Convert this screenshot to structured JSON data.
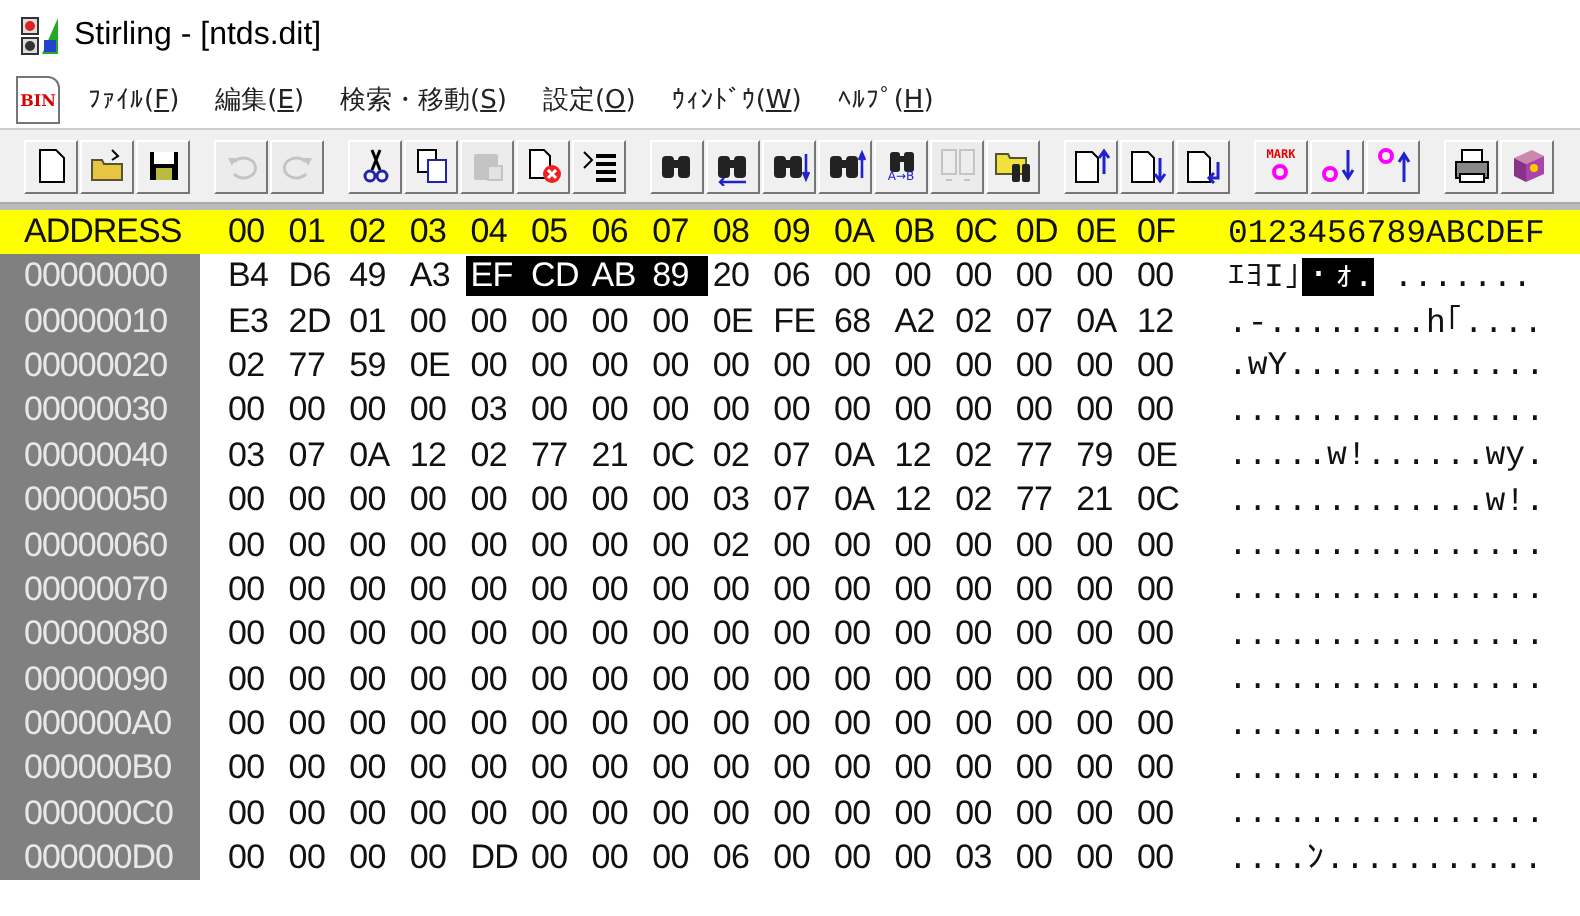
{
  "window": {
    "title": "Stirling - [ntds.dit]"
  },
  "menu": {
    "icon_caption": "BIN",
    "items": [
      {
        "label": "ﾌｧｲﾙ(F)"
      },
      {
        "label": "編集(E)"
      },
      {
        "label": "検索・移動(S)"
      },
      {
        "label": "設定(O)"
      },
      {
        "label": "ｳｨﾝﾄﾞｳ(W)"
      },
      {
        "label": "ﾍﾙﾌﾟ(H)"
      }
    ]
  },
  "toolbar": {
    "groups": [
      {
        "items": [
          {
            "kind": "new",
            "disabled": false
          },
          {
            "kind": "open",
            "disabled": false
          },
          {
            "kind": "save",
            "disabled": false
          }
        ]
      },
      {
        "items": [
          {
            "kind": "undo",
            "disabled": true
          },
          {
            "kind": "redo",
            "disabled": true
          }
        ]
      },
      {
        "items": [
          {
            "kind": "cut",
            "disabled": false
          },
          {
            "kind": "copy",
            "disabled": false
          },
          {
            "kind": "paste",
            "disabled": true
          },
          {
            "kind": "delete",
            "disabled": false
          },
          {
            "kind": "list",
            "disabled": false
          }
        ]
      },
      {
        "items": [
          {
            "kind": "find",
            "disabled": false
          },
          {
            "kind": "replace",
            "disabled": false
          },
          {
            "kind": "find-down",
            "disabled": false
          },
          {
            "kind": "find-up",
            "disabled": false
          },
          {
            "kind": "compare",
            "caption": "A→B",
            "disabled": false
          },
          {
            "kind": "pages",
            "disabled": true
          },
          {
            "kind": "folder-find",
            "disabled": false
          }
        ]
      },
      {
        "items": [
          {
            "kind": "page-up",
            "disabled": false
          },
          {
            "kind": "page-down",
            "disabled": false
          },
          {
            "kind": "page-jump",
            "disabled": false
          }
        ]
      },
      {
        "items": [
          {
            "kind": "mark",
            "caption": "MARK",
            "disabled": false
          },
          {
            "kind": "mark-down",
            "disabled": false
          },
          {
            "kind": "mark-up",
            "disabled": false
          }
        ]
      },
      {
        "items": [
          {
            "kind": "print",
            "disabled": false
          },
          {
            "kind": "help",
            "disabled": false
          }
        ]
      }
    ]
  },
  "hex": {
    "header": {
      "address": "ADDRESS",
      "columns": [
        "00",
        "01",
        "02",
        "03",
        "04",
        "05",
        "06",
        "07",
        "08",
        "09",
        "0A",
        "0B",
        "0C",
        "0D",
        "0E",
        "0F"
      ],
      "ascii": "0123456789ABCDEF"
    },
    "rows": [
      {
        "address": "00000000",
        "bytes": [
          {
            "value": "B4",
            "selected": false
          },
          {
            "value": "D6",
            "selected": false
          },
          {
            "value": "49",
            "selected": false
          },
          {
            "value": "A3",
            "selected": false
          },
          {
            "value": "EF",
            "selected": true
          },
          {
            "value": "CD",
            "selected": true
          },
          {
            "value": "AB",
            "selected": true
          },
          {
            "value": "89",
            "selected": true
          },
          {
            "value": "20",
            "selected": false
          },
          {
            "value": "06",
            "selected": false
          },
          {
            "value": "00",
            "selected": false
          },
          {
            "value": "00",
            "selected": false
          },
          {
            "value": "00",
            "selected": false
          },
          {
            "value": "00",
            "selected": false
          },
          {
            "value": "00",
            "selected": false
          },
          {
            "value": "00",
            "selected": false
          }
        ],
        "ascii": [
          {
            "text": "ｴﾖI｣",
            "selected": false
          },
          {
            "text": "・ｫ.",
            "selected": true
          },
          {
            "text": " .......",
            "selected": false
          }
        ]
      },
      {
        "address": "00000010",
        "bytes": [
          {
            "value": "E3",
            "selected": false
          },
          {
            "value": "2D",
            "selected": false
          },
          {
            "value": "01",
            "selected": false
          },
          {
            "value": "00",
            "selected": false
          },
          {
            "value": "00",
            "selected": false
          },
          {
            "value": "00",
            "selected": false
          },
          {
            "value": "00",
            "selected": false
          },
          {
            "value": "00",
            "selected": false
          },
          {
            "value": "0E",
            "selected": false
          },
          {
            "value": "FE",
            "selected": false
          },
          {
            "value": "68",
            "selected": false
          },
          {
            "value": "A2",
            "selected": false
          },
          {
            "value": "02",
            "selected": false
          },
          {
            "value": "07",
            "selected": false
          },
          {
            "value": "0A",
            "selected": false
          },
          {
            "value": "12",
            "selected": false
          }
        ],
        "ascii": [
          {
            "text": ".-........h｢....",
            "selected": false
          }
        ]
      },
      {
        "address": "00000020",
        "bytes": [
          {
            "value": "02",
            "selected": false
          },
          {
            "value": "77",
            "selected": false
          },
          {
            "value": "59",
            "selected": false
          },
          {
            "value": "0E",
            "selected": false
          },
          {
            "value": "00",
            "selected": false
          },
          {
            "value": "00",
            "selected": false
          },
          {
            "value": "00",
            "selected": false
          },
          {
            "value": "00",
            "selected": false
          },
          {
            "value": "00",
            "selected": false
          },
          {
            "value": "00",
            "selected": false
          },
          {
            "value": "00",
            "selected": false
          },
          {
            "value": "00",
            "selected": false
          },
          {
            "value": "00",
            "selected": false
          },
          {
            "value": "00",
            "selected": false
          },
          {
            "value": "00",
            "selected": false
          },
          {
            "value": "00",
            "selected": false
          }
        ],
        "ascii": [
          {
            "text": ".wY.............",
            "selected": false
          }
        ]
      },
      {
        "address": "00000030",
        "bytes": [
          {
            "value": "00",
            "selected": false
          },
          {
            "value": "00",
            "selected": false
          },
          {
            "value": "00",
            "selected": false
          },
          {
            "value": "00",
            "selected": false
          },
          {
            "value": "03",
            "selected": false
          },
          {
            "value": "00",
            "selected": false
          },
          {
            "value": "00",
            "selected": false
          },
          {
            "value": "00",
            "selected": false
          },
          {
            "value": "00",
            "selected": false
          },
          {
            "value": "00",
            "selected": false
          },
          {
            "value": "00",
            "selected": false
          },
          {
            "value": "00",
            "selected": false
          },
          {
            "value": "00",
            "selected": false
          },
          {
            "value": "00",
            "selected": false
          },
          {
            "value": "00",
            "selected": false
          },
          {
            "value": "00",
            "selected": false
          }
        ],
        "ascii": [
          {
            "text": "................",
            "selected": false
          }
        ]
      },
      {
        "address": "00000040",
        "bytes": [
          {
            "value": "03",
            "selected": false
          },
          {
            "value": "07",
            "selected": false
          },
          {
            "value": "0A",
            "selected": false
          },
          {
            "value": "12",
            "selected": false
          },
          {
            "value": "02",
            "selected": false
          },
          {
            "value": "77",
            "selected": false
          },
          {
            "value": "21",
            "selected": false
          },
          {
            "value": "0C",
            "selected": false
          },
          {
            "value": "02",
            "selected": false
          },
          {
            "value": "07",
            "selected": false
          },
          {
            "value": "0A",
            "selected": false
          },
          {
            "value": "12",
            "selected": false
          },
          {
            "value": "02",
            "selected": false
          },
          {
            "value": "77",
            "selected": false
          },
          {
            "value": "79",
            "selected": false
          },
          {
            "value": "0E",
            "selected": false
          }
        ],
        "ascii": [
          {
            "text": ".....w!......wy.",
            "selected": false
          }
        ]
      },
      {
        "address": "00000050",
        "bytes": [
          {
            "value": "00",
            "selected": false
          },
          {
            "value": "00",
            "selected": false
          },
          {
            "value": "00",
            "selected": false
          },
          {
            "value": "00",
            "selected": false
          },
          {
            "value": "00",
            "selected": false
          },
          {
            "value": "00",
            "selected": false
          },
          {
            "value": "00",
            "selected": false
          },
          {
            "value": "00",
            "selected": false
          },
          {
            "value": "03",
            "selected": false
          },
          {
            "value": "07",
            "selected": false
          },
          {
            "value": "0A",
            "selected": false
          },
          {
            "value": "12",
            "selected": false
          },
          {
            "value": "02",
            "selected": false
          },
          {
            "value": "77",
            "selected": false
          },
          {
            "value": "21",
            "selected": false
          },
          {
            "value": "0C",
            "selected": false
          }
        ],
        "ascii": [
          {
            "text": ".............w!.",
            "selected": false
          }
        ]
      },
      {
        "address": "00000060",
        "bytes": [
          {
            "value": "00",
            "selected": false
          },
          {
            "value": "00",
            "selected": false
          },
          {
            "value": "00",
            "selected": false
          },
          {
            "value": "00",
            "selected": false
          },
          {
            "value": "00",
            "selected": false
          },
          {
            "value": "00",
            "selected": false
          },
          {
            "value": "00",
            "selected": false
          },
          {
            "value": "00",
            "selected": false
          },
          {
            "value": "02",
            "selected": false
          },
          {
            "value": "00",
            "selected": false
          },
          {
            "value": "00",
            "selected": false
          },
          {
            "value": "00",
            "selected": false
          },
          {
            "value": "00",
            "selected": false
          },
          {
            "value": "00",
            "selected": false
          },
          {
            "value": "00",
            "selected": false
          },
          {
            "value": "00",
            "selected": false
          }
        ],
        "ascii": [
          {
            "text": "................",
            "selected": false
          }
        ]
      },
      {
        "address": "00000070",
        "bytes": [
          {
            "value": "00",
            "selected": false
          },
          {
            "value": "00",
            "selected": false
          },
          {
            "value": "00",
            "selected": false
          },
          {
            "value": "00",
            "selected": false
          },
          {
            "value": "00",
            "selected": false
          },
          {
            "value": "00",
            "selected": false
          },
          {
            "value": "00",
            "selected": false
          },
          {
            "value": "00",
            "selected": false
          },
          {
            "value": "00",
            "selected": false
          },
          {
            "value": "00",
            "selected": false
          },
          {
            "value": "00",
            "selected": false
          },
          {
            "value": "00",
            "selected": false
          },
          {
            "value": "00",
            "selected": false
          },
          {
            "value": "00",
            "selected": false
          },
          {
            "value": "00",
            "selected": false
          },
          {
            "value": "00",
            "selected": false
          }
        ],
        "ascii": [
          {
            "text": "................",
            "selected": false
          }
        ]
      },
      {
        "address": "00000080",
        "bytes": [
          {
            "value": "00",
            "selected": false
          },
          {
            "value": "00",
            "selected": false
          },
          {
            "value": "00",
            "selected": false
          },
          {
            "value": "00",
            "selected": false
          },
          {
            "value": "00",
            "selected": false
          },
          {
            "value": "00",
            "selected": false
          },
          {
            "value": "00",
            "selected": false
          },
          {
            "value": "00",
            "selected": false
          },
          {
            "value": "00",
            "selected": false
          },
          {
            "value": "00",
            "selected": false
          },
          {
            "value": "00",
            "selected": false
          },
          {
            "value": "00",
            "selected": false
          },
          {
            "value": "00",
            "selected": false
          },
          {
            "value": "00",
            "selected": false
          },
          {
            "value": "00",
            "selected": false
          },
          {
            "value": "00",
            "selected": false
          }
        ],
        "ascii": [
          {
            "text": "................",
            "selected": false
          }
        ]
      },
      {
        "address": "00000090",
        "bytes": [
          {
            "value": "00",
            "selected": false
          },
          {
            "value": "00",
            "selected": false
          },
          {
            "value": "00",
            "selected": false
          },
          {
            "value": "00",
            "selected": false
          },
          {
            "value": "00",
            "selected": false
          },
          {
            "value": "00",
            "selected": false
          },
          {
            "value": "00",
            "selected": false
          },
          {
            "value": "00",
            "selected": false
          },
          {
            "value": "00",
            "selected": false
          },
          {
            "value": "00",
            "selected": false
          },
          {
            "value": "00",
            "selected": false
          },
          {
            "value": "00",
            "selected": false
          },
          {
            "value": "00",
            "selected": false
          },
          {
            "value": "00",
            "selected": false
          },
          {
            "value": "00",
            "selected": false
          },
          {
            "value": "00",
            "selected": false
          }
        ],
        "ascii": [
          {
            "text": "................",
            "selected": false
          }
        ]
      },
      {
        "address": "000000A0",
        "bytes": [
          {
            "value": "00",
            "selected": false
          },
          {
            "value": "00",
            "selected": false
          },
          {
            "value": "00",
            "selected": false
          },
          {
            "value": "00",
            "selected": false
          },
          {
            "value": "00",
            "selected": false
          },
          {
            "value": "00",
            "selected": false
          },
          {
            "value": "00",
            "selected": false
          },
          {
            "value": "00",
            "selected": false
          },
          {
            "value": "00",
            "selected": false
          },
          {
            "value": "00",
            "selected": false
          },
          {
            "value": "00",
            "selected": false
          },
          {
            "value": "00",
            "selected": false
          },
          {
            "value": "00",
            "selected": false
          },
          {
            "value": "00",
            "selected": false
          },
          {
            "value": "00",
            "selected": false
          },
          {
            "value": "00",
            "selected": false
          }
        ],
        "ascii": [
          {
            "text": "................",
            "selected": false
          }
        ]
      },
      {
        "address": "000000B0",
        "bytes": [
          {
            "value": "00",
            "selected": false
          },
          {
            "value": "00",
            "selected": false
          },
          {
            "value": "00",
            "selected": false
          },
          {
            "value": "00",
            "selected": false
          },
          {
            "value": "00",
            "selected": false
          },
          {
            "value": "00",
            "selected": false
          },
          {
            "value": "00",
            "selected": false
          },
          {
            "value": "00",
            "selected": false
          },
          {
            "value": "00",
            "selected": false
          },
          {
            "value": "00",
            "selected": false
          },
          {
            "value": "00",
            "selected": false
          },
          {
            "value": "00",
            "selected": false
          },
          {
            "value": "00",
            "selected": false
          },
          {
            "value": "00",
            "selected": false
          },
          {
            "value": "00",
            "selected": false
          },
          {
            "value": "00",
            "selected": false
          }
        ],
        "ascii": [
          {
            "text": "................",
            "selected": false
          }
        ]
      },
      {
        "address": "000000C0",
        "bytes": [
          {
            "value": "00",
            "selected": false
          },
          {
            "value": "00",
            "selected": false
          },
          {
            "value": "00",
            "selected": false
          },
          {
            "value": "00",
            "selected": false
          },
          {
            "value": "00",
            "selected": false
          },
          {
            "value": "00",
            "selected": false
          },
          {
            "value": "00",
            "selected": false
          },
          {
            "value": "00",
            "selected": false
          },
          {
            "value": "00",
            "selected": false
          },
          {
            "value": "00",
            "selected": false
          },
          {
            "value": "00",
            "selected": false
          },
          {
            "value": "00",
            "selected": false
          },
          {
            "value": "00",
            "selected": false
          },
          {
            "value": "00",
            "selected": false
          },
          {
            "value": "00",
            "selected": false
          },
          {
            "value": "00",
            "selected": false
          }
        ],
        "ascii": [
          {
            "text": "................",
            "selected": false
          }
        ]
      },
      {
        "address": "000000D0",
        "bytes": [
          {
            "value": "00",
            "selected": false
          },
          {
            "value": "00",
            "selected": false
          },
          {
            "value": "00",
            "selected": false
          },
          {
            "value": "00",
            "selected": false
          },
          {
            "value": "DD",
            "selected": false
          },
          {
            "value": "00",
            "selected": false
          },
          {
            "value": "00",
            "selected": false
          },
          {
            "value": "00",
            "selected": false
          },
          {
            "value": "06",
            "selected": false
          },
          {
            "value": "00",
            "selected": false
          },
          {
            "value": "00",
            "selected": false
          },
          {
            "value": "00",
            "selected": false
          },
          {
            "value": "03",
            "selected": false
          },
          {
            "value": "00",
            "selected": false
          },
          {
            "value": "00",
            "selected": false
          },
          {
            "value": "00",
            "selected": false
          }
        ],
        "ascii": [
          {
            "text": "....ﾝ...........",
            "selected": false
          }
        ]
      }
    ]
  }
}
